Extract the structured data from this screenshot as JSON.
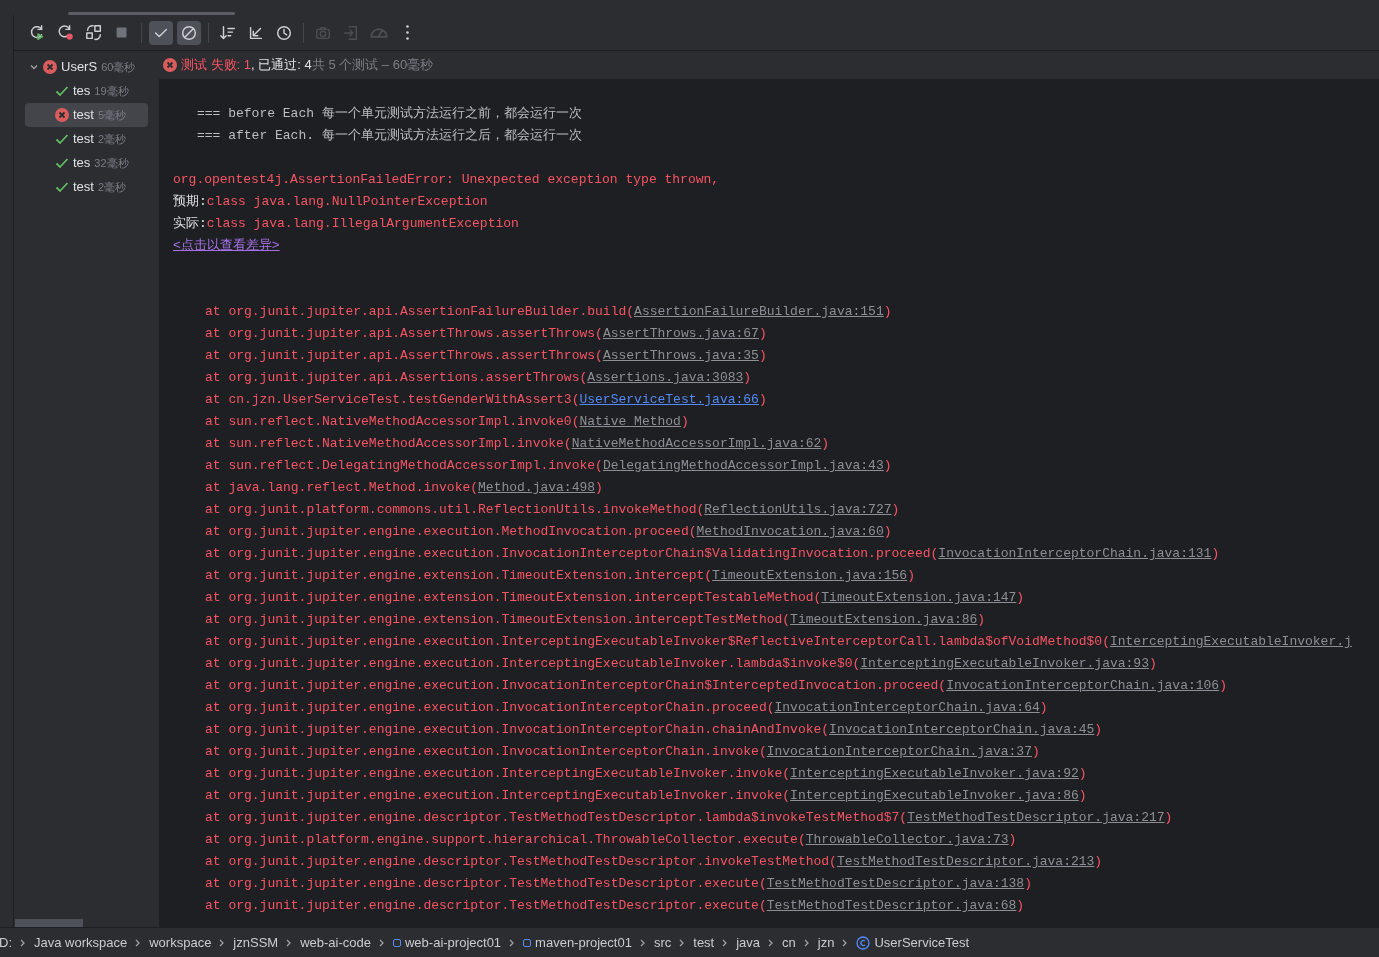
{
  "toolbar": [
    {
      "kind": "rerun",
      "selected": false,
      "disabled": false
    },
    {
      "kind": "rerun-failed",
      "selected": false,
      "disabled": false
    },
    {
      "kind": "auto-test",
      "selected": false,
      "disabled": false
    },
    {
      "kind": "stop",
      "selected": false,
      "disabled": false
    },
    {
      "kind": "show-passed",
      "selected": true,
      "disabled": false
    },
    {
      "kind": "show-ignored",
      "selected": true,
      "disabled": false
    },
    {
      "kind": "sort",
      "selected": false,
      "disabled": false
    },
    {
      "kind": "collapse",
      "selected": false,
      "disabled": false
    },
    {
      "kind": "history",
      "selected": false,
      "disabled": false
    },
    {
      "kind": "camera",
      "selected": false,
      "disabled": true
    },
    {
      "kind": "import",
      "selected": false,
      "disabled": true
    },
    {
      "kind": "gauge",
      "selected": false,
      "disabled": true
    },
    {
      "kind": "more",
      "selected": false,
      "disabled": false
    }
  ],
  "test_tree": {
    "name": "UserS",
    "time": "60毫秒",
    "kind": "failed",
    "expanded": true,
    "selected": false,
    "children": [
      {
        "name": "tes",
        "time": "19毫秒",
        "kind": "passed",
        "selected": false
      },
      {
        "name": "test",
        "time": "5毫秒",
        "kind": "failed",
        "selected": true
      },
      {
        "name": "test",
        "time": "2毫秒",
        "kind": "passed",
        "selected": false
      },
      {
        "name": "tes",
        "time": "32毫秒",
        "kind": "passed",
        "selected": false
      },
      {
        "name": "test",
        "time": "2毫秒",
        "kind": "passed",
        "selected": false
      }
    ]
  },
  "summary": {
    "kind": "failed",
    "failed": "测试 失败: 1",
    "passed": ", 已通过: 4",
    "total": "共 5 个测试 – 60毫秒"
  },
  "output": {
    "log_lines": [
      "=== before Each 每一个单元测试方法运行之前，都会运行一次",
      "=== after Each. 每一个单元测试方法运行之后，都会运行一次"
    ],
    "error": "org.opentest4j.AssertionFailedError: Unexpected exception type thrown,",
    "expected": {
      "label": "预期:",
      "value": "class java.lang.NullPointerException"
    },
    "actual": {
      "label": "实际:",
      "value": "class java.lang.IllegalArgumentException"
    },
    "diff_link": "<点击以查看差异>",
    "frames": [
      {
        "method": "at org.junit.jupiter.api.AssertionFailureBuilder.build(",
        "location": "AssertionFailureBuilder.java:151",
        "close": ")"
      },
      {
        "method": "at org.junit.jupiter.api.AssertThrows.assertThrows(",
        "location": "AssertThrows.java:67",
        "close": ")"
      },
      {
        "method": "at org.junit.jupiter.api.AssertThrows.assertThrows(",
        "location": "AssertThrows.java:35",
        "close": ")"
      },
      {
        "method": "at org.junit.jupiter.api.Assertions.assertThrows(",
        "location": "Assertions.java:3083",
        "close": ")"
      },
      {
        "method": "at cn.jzn.UserServiceTest.testGenderWithAssert3(",
        "location": "UserServiceTest.java:66",
        "close": ")",
        "own": true
      },
      {
        "method": "at sun.reflect.NativeMethodAccessorImpl.invoke0(",
        "location": "Native Method",
        "close": ")"
      },
      {
        "method": "at sun.reflect.NativeMethodAccessorImpl.invoke(",
        "location": "NativeMethodAccessorImpl.java:62",
        "close": ")"
      },
      {
        "method": "at sun.reflect.DelegatingMethodAccessorImpl.invoke(",
        "location": "DelegatingMethodAccessorImpl.java:43",
        "close": ")"
      },
      {
        "method": "at java.lang.reflect.Method.invoke(",
        "location": "Method.java:498",
        "close": ")"
      },
      {
        "method": "at org.junit.platform.commons.util.ReflectionUtils.invokeMethod(",
        "location": "ReflectionUtils.java:727",
        "close": ")"
      },
      {
        "method": "at org.junit.jupiter.engine.execution.MethodInvocation.proceed(",
        "location": "MethodInvocation.java:60",
        "close": ")"
      },
      {
        "method": "at org.junit.jupiter.engine.execution.InvocationInterceptorChain$ValidatingInvocation.proceed(",
        "location": "InvocationInterceptorChain.java:131",
        "close": ")"
      },
      {
        "method": "at org.junit.jupiter.engine.extension.TimeoutExtension.intercept(",
        "location": "TimeoutExtension.java:156",
        "close": ")"
      },
      {
        "method": "at org.junit.jupiter.engine.extension.TimeoutExtension.interceptTestableMethod(",
        "location": "TimeoutExtension.java:147",
        "close": ")"
      },
      {
        "method": "at org.junit.jupiter.engine.extension.TimeoutExtension.interceptTestMethod(",
        "location": "TimeoutExtension.java:86",
        "close": ")"
      },
      {
        "method": "at org.junit.jupiter.engine.execution.InterceptingExecutableInvoker$ReflectiveInterceptorCall.lambda$ofVoidMethod$0(",
        "location": "InterceptingExecutableInvoker.j"
      },
      {
        "method": "at org.junit.jupiter.engine.execution.InterceptingExecutableInvoker.lambda$invoke$0(",
        "location": "InterceptingExecutableInvoker.java:93",
        "close": ")"
      },
      {
        "method": "at org.junit.jupiter.engine.execution.InvocationInterceptorChain$InterceptedInvocation.proceed(",
        "location": "InvocationInterceptorChain.java:106",
        "close": ")"
      },
      {
        "method": "at org.junit.jupiter.engine.execution.InvocationInterceptorChain.proceed(",
        "location": "InvocationInterceptorChain.java:64",
        "close": ")"
      },
      {
        "method": "at org.junit.jupiter.engine.execution.InvocationInterceptorChain.chainAndInvoke(",
        "location": "InvocationInterceptorChain.java:45",
        "close": ")"
      },
      {
        "method": "at org.junit.jupiter.engine.execution.InvocationInterceptorChain.invoke(",
        "location": "InvocationInterceptorChain.java:37",
        "close": ")"
      },
      {
        "method": "at org.junit.jupiter.engine.execution.InterceptingExecutableInvoker.invoke(",
        "location": "InterceptingExecutableInvoker.java:92",
        "close": ")"
      },
      {
        "method": "at org.junit.jupiter.engine.execution.InterceptingExecutableInvoker.invoke(",
        "location": "InterceptingExecutableInvoker.java:86",
        "close": ")"
      },
      {
        "method": "at org.junit.jupiter.engine.descriptor.TestMethodTestDescriptor.lambda$invokeTestMethod$7(",
        "location": "TestMethodTestDescriptor.java:217",
        "close": ")"
      },
      {
        "method": "at org.junit.platform.engine.support.hierarchical.ThrowableCollector.execute(",
        "location": "ThrowableCollector.java:73",
        "close": ")"
      },
      {
        "method": "at org.junit.jupiter.engine.descriptor.TestMethodTestDescriptor.invokeTestMethod(",
        "location": "TestMethodTestDescriptor.java:213",
        "close": ")"
      },
      {
        "method": "at org.junit.jupiter.engine.descriptor.TestMethodTestDescriptor.execute(",
        "location": "TestMethodTestDescriptor.java:138",
        "close": ")"
      },
      {
        "method": "at org.junit.jupiter.engine.descriptor.TestMethodTestDescriptor.execute(",
        "location": "TestMethodTestDescriptor.java:68",
        "close": ")"
      }
    ]
  },
  "breadcrumbs": [
    {
      "label": "D:",
      "kind": "folder"
    },
    {
      "label": "Java workspace",
      "kind": "folder"
    },
    {
      "label": "workspace",
      "kind": "folder"
    },
    {
      "label": "jznSSM",
      "kind": "folder"
    },
    {
      "label": "web-ai-code",
      "kind": "folder"
    },
    {
      "label": "web-ai-project01",
      "kind": "module"
    },
    {
      "label": "maven-project01",
      "kind": "module"
    },
    {
      "label": "src",
      "kind": "folder"
    },
    {
      "label": "test",
      "kind": "folder"
    },
    {
      "label": "java",
      "kind": "folder"
    },
    {
      "label": "cn",
      "kind": "folder"
    },
    {
      "label": "jzn",
      "kind": "folder"
    },
    {
      "label": "UserServiceTest",
      "kind": "class"
    }
  ]
}
